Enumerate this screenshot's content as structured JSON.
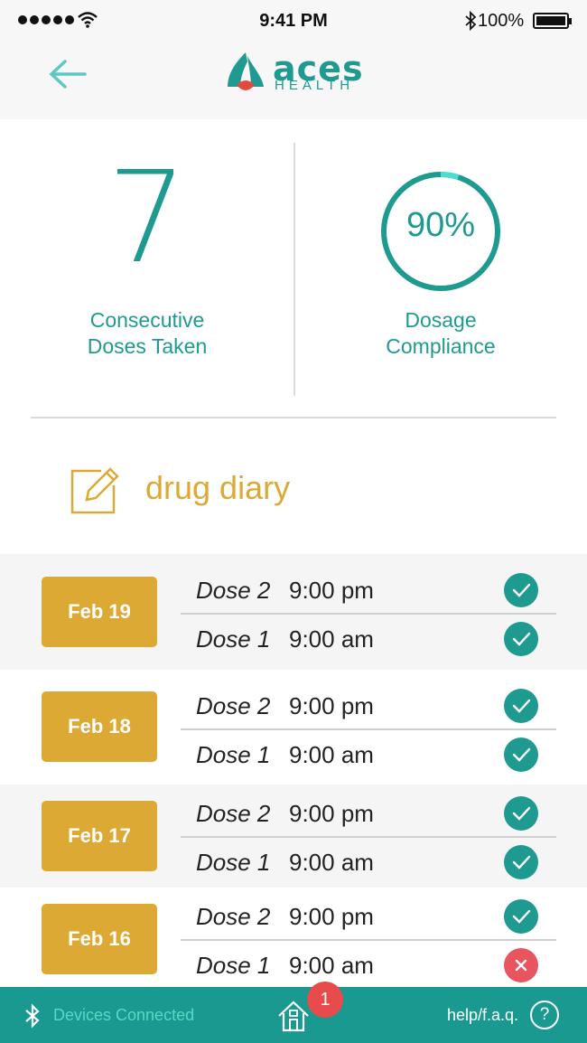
{
  "status_bar": {
    "time": "9:41 PM",
    "battery": "100%"
  },
  "header": {
    "logo_main": "aces",
    "logo_sub": "HEALTH"
  },
  "stats": {
    "consecutive_doses": "7",
    "consecutive_caption_line1": "Consecutive",
    "consecutive_caption_line2": "Doses Taken",
    "compliance_percent": 90,
    "compliance_label": "90%",
    "compliance_caption_line1": "Dosage",
    "compliance_caption_line2": "Compliance"
  },
  "diary": {
    "label": "drug diary"
  },
  "days": [
    {
      "date": "Feb 19",
      "doses": [
        {
          "name": "Dose 2",
          "time": "9:00 pm",
          "status": "taken"
        },
        {
          "name": "Dose 1",
          "time": "9:00 am",
          "status": "taken"
        }
      ]
    },
    {
      "date": "Feb 18",
      "doses": [
        {
          "name": "Dose 2",
          "time": "9:00 pm",
          "status": "taken"
        },
        {
          "name": "Dose 1",
          "time": "9:00 am",
          "status": "taken"
        }
      ]
    },
    {
      "date": "Feb 17",
      "doses": [
        {
          "name": "Dose 2",
          "time": "9:00 pm",
          "status": "taken"
        },
        {
          "name": "Dose 1",
          "time": "9:00 am",
          "status": "taken"
        }
      ]
    },
    {
      "date": "Feb 16",
      "doses": [
        {
          "name": "Dose 2",
          "time": "9:00 pm",
          "status": "taken"
        },
        {
          "name": "Dose 1",
          "time": "9:00 am",
          "status": "missed"
        }
      ]
    }
  ],
  "footer": {
    "devices_label": "Devices Connected",
    "home_badge": "1",
    "help_label": "help/f.a.q.",
    "help_icon": "?"
  },
  "colors": {
    "teal": "#1f9a91",
    "gold": "#dca934",
    "missed": "#e8555f",
    "footer": "#1a9990"
  }
}
